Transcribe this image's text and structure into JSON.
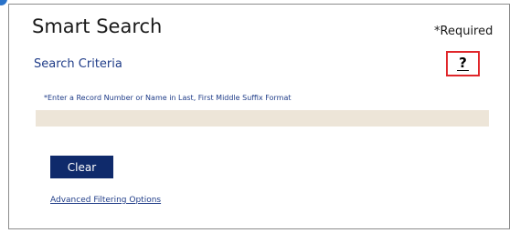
{
  "header": {
    "title": "Smart Search",
    "required_note": "*Required"
  },
  "search": {
    "section_label": "Search Criteria",
    "help_glyph": "?",
    "hint": "*Enter a Record Number or Name in Last, First Middle Suffix Format",
    "input_value": "",
    "input_placeholder": ""
  },
  "actions": {
    "clear_label": "Clear",
    "advanced_link": "Advanced Filtering Options"
  },
  "colors": {
    "button_bg": "#0f2a6b",
    "link": "#1f3c88",
    "input_bg": "#ede5d8",
    "help_border": "#e0262a"
  }
}
